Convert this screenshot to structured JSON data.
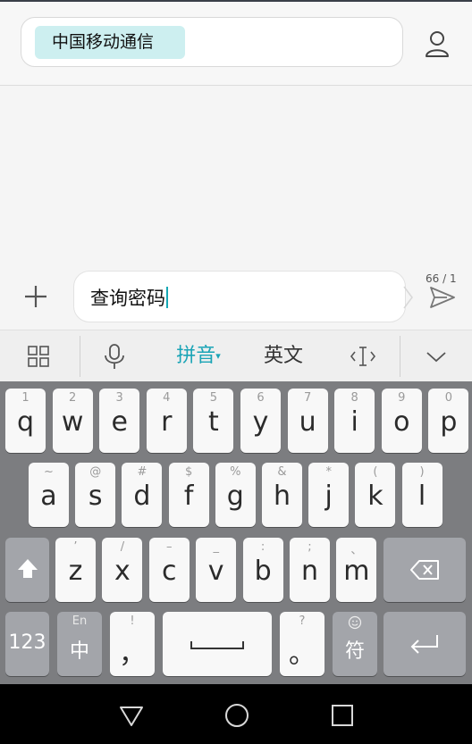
{
  "recipient": {
    "chip_label": "中国移动通信"
  },
  "compose": {
    "text": "查询密码",
    "counter": "66 / 1"
  },
  "ime_toolbar": {
    "pinyin_label": "拼音",
    "english_label": "英文"
  },
  "keyboard": {
    "row1": [
      {
        "main": "q",
        "sub": "1"
      },
      {
        "main": "w",
        "sub": "2"
      },
      {
        "main": "e",
        "sub": "3"
      },
      {
        "main": "r",
        "sub": "4"
      },
      {
        "main": "t",
        "sub": "5"
      },
      {
        "main": "y",
        "sub": "6"
      },
      {
        "main": "u",
        "sub": "7"
      },
      {
        "main": "i",
        "sub": "8"
      },
      {
        "main": "o",
        "sub": "9"
      },
      {
        "main": "p",
        "sub": "0"
      }
    ],
    "row2": [
      {
        "main": "a",
        "sub": "~"
      },
      {
        "main": "s",
        "sub": "@"
      },
      {
        "main": "d",
        "sub": "#"
      },
      {
        "main": "f",
        "sub": "$"
      },
      {
        "main": "g",
        "sub": "%"
      },
      {
        "main": "h",
        "sub": "&"
      },
      {
        "main": "j",
        "sub": "*"
      },
      {
        "main": "k",
        "sub": "("
      },
      {
        "main": "l",
        "sub": ")"
      }
    ],
    "row3": [
      {
        "main": "z",
        "sub": "’"
      },
      {
        "main": "x",
        "sub": "/"
      },
      {
        "main": "c",
        "sub": "–"
      },
      {
        "main": "v",
        "sub": "_"
      },
      {
        "main": "b",
        "sub": ":"
      },
      {
        "main": "n",
        "sub": ";"
      },
      {
        "main": "m",
        "sub": "、"
      }
    ],
    "row4": {
      "num_label": "123",
      "lang_sub": "En",
      "lang_main": "中",
      "comma_sub": "!",
      "comma_main": "，",
      "period_sub": "?",
      "period_main": "。",
      "symbol_main": "符"
    }
  },
  "colors": {
    "accent": "#1aa4b6",
    "chip_bg": "#cdeff0",
    "keyboard_bg": "#7c7d80"
  }
}
